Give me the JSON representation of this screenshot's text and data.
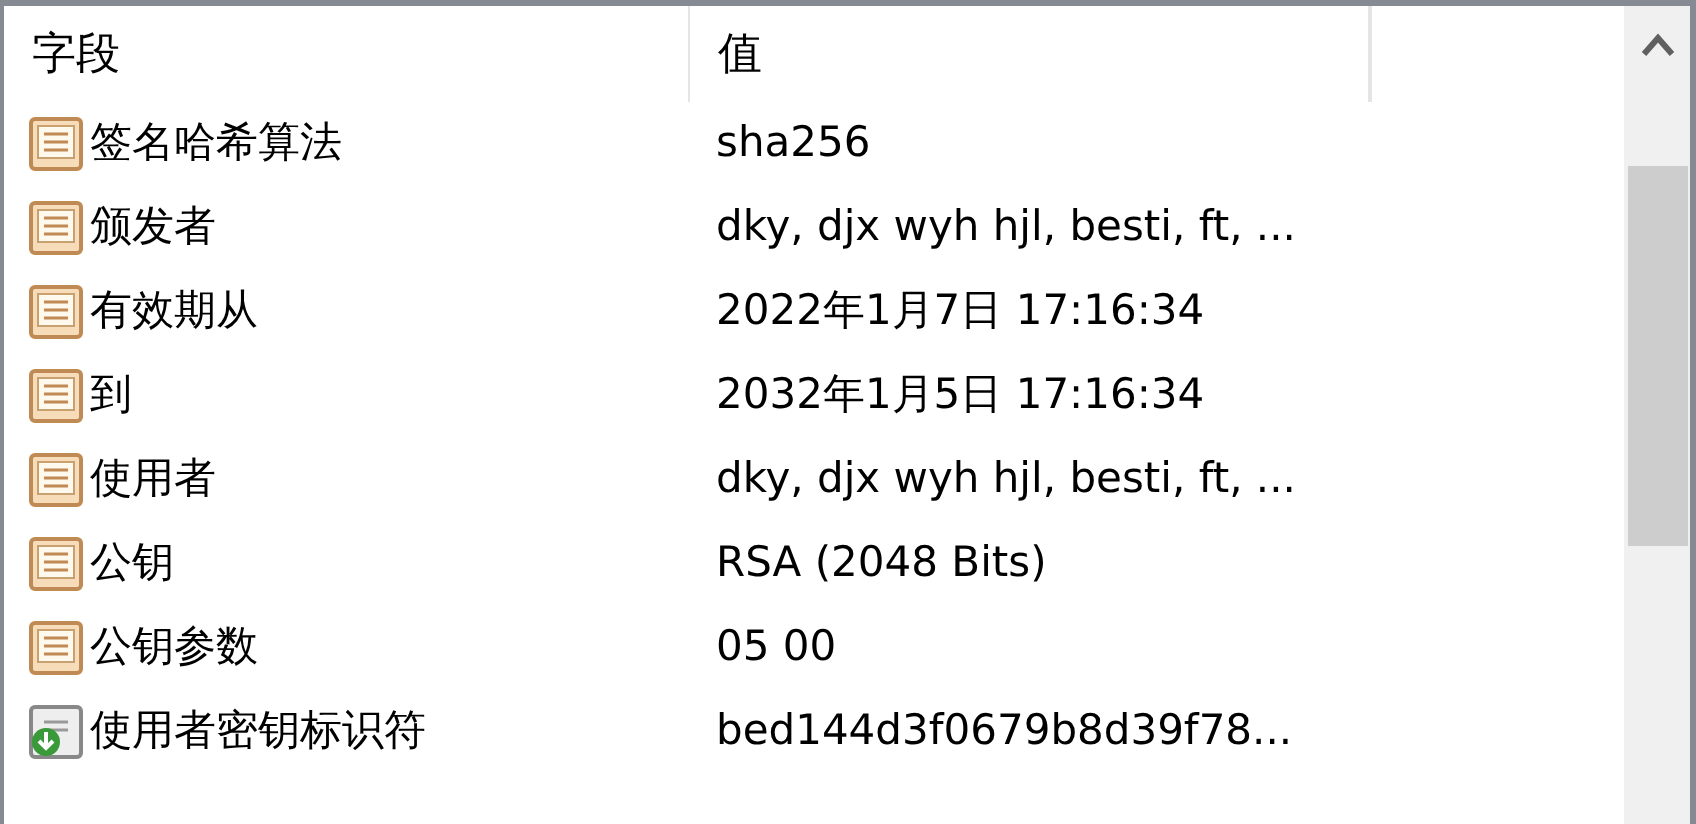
{
  "columns": [
    "字段",
    "值"
  ],
  "rows": [
    {
      "kind": "property",
      "field": "签名哈希算法",
      "value": "sha256"
    },
    {
      "kind": "property",
      "field": "颁发者",
      "value": "dky, djx wyh hjl, besti, ft, ..."
    },
    {
      "kind": "property",
      "field": "有效期从",
      "value": "2022年1月7日 17:16:34"
    },
    {
      "kind": "property",
      "field": "到",
      "value": "2032年1月5日 17:16:34"
    },
    {
      "kind": "property",
      "field": "使用者",
      "value": "dky, djx wyh hjl, besti, ft, ..."
    },
    {
      "kind": "property",
      "field": "公钥",
      "value": "RSA (2048 Bits)"
    },
    {
      "kind": "property",
      "field": "公钥参数",
      "value": "05 00"
    },
    {
      "kind": "extension",
      "field": "使用者密钥标识符",
      "value": "bed144d3f0679b8d39f78..."
    }
  ]
}
